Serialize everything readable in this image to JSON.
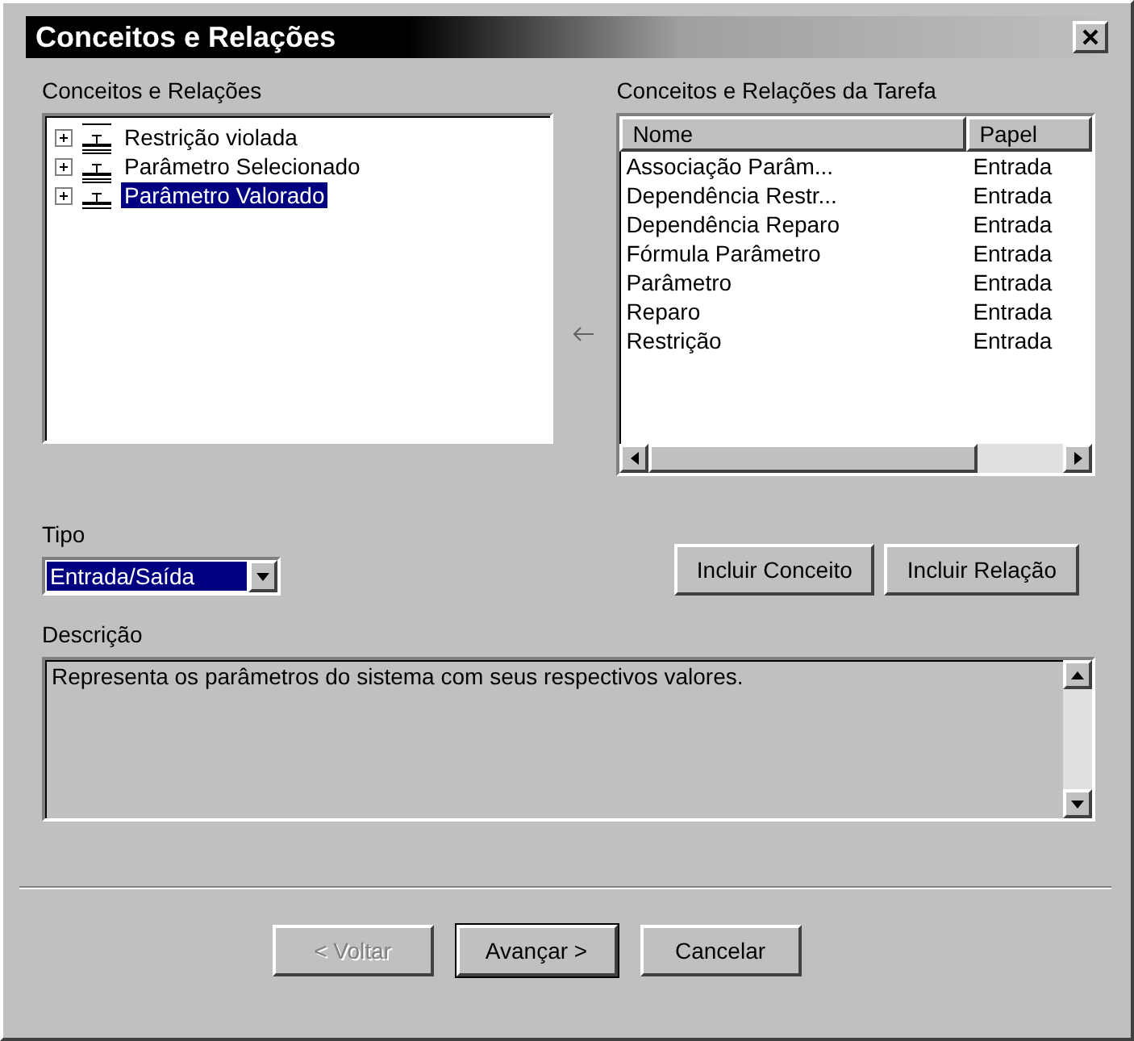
{
  "window": {
    "title": "Conceitos e Relações"
  },
  "concepts": {
    "label": "Conceitos e Relações",
    "items": [
      {
        "label": "Restrição violada",
        "expanded": false,
        "selected": false
      },
      {
        "label": "Parâmetro Selecionado",
        "expanded": false,
        "selected": false
      },
      {
        "label": "Parâmetro Valorado",
        "expanded": false,
        "selected": true
      }
    ]
  },
  "task": {
    "label": "Conceitos e Relações da Tarefa",
    "columns": [
      "Nome",
      "Papel"
    ],
    "rows": [
      [
        "Associação Parâm...",
        "Entrada"
      ],
      [
        "Dependência Restr...",
        "Entrada"
      ],
      [
        "Dependência Reparo",
        "Entrada"
      ],
      [
        "Fórmula Parâmetro",
        "Entrada"
      ],
      [
        "Parâmetro",
        "Entrada"
      ],
      [
        "Reparo",
        "Entrada"
      ],
      [
        "Restrição",
        "Entrada"
      ]
    ]
  },
  "tipo": {
    "label": "Tipo",
    "value": "Entrada/Saída"
  },
  "actions": [
    {
      "label": "Incluir Conceito"
    },
    {
      "label": "Incluir Relação"
    }
  ],
  "descricao": {
    "label": "Descrição",
    "value": "Representa os parâmetros do sistema com seus respectivos valores."
  },
  "buttons": [
    {
      "label": "< Voltar",
      "disabled": true,
      "default": false
    },
    {
      "label": "Avançar >",
      "disabled": false,
      "default": true
    },
    {
      "label": "Cancelar",
      "disabled": false,
      "default": false
    }
  ]
}
